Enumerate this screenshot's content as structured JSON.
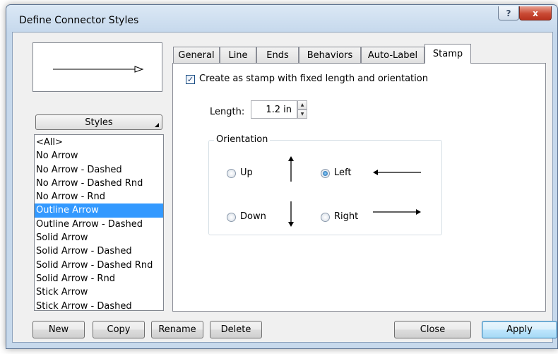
{
  "window": {
    "title": "Define Connector Styles",
    "help_glyph": "?",
    "close_glyph": "x"
  },
  "styles_button": "Styles",
  "style_list": [
    "<All>",
    "No Arrow",
    "No Arrow - Dashed",
    "No Arrow - Dashed Rnd",
    "No Arrow - Rnd",
    "Outline Arrow",
    "Outline Arrow - Dashed",
    "Solid Arrow",
    "Solid Arrow - Dashed",
    "Solid Arrow - Dashed Rnd",
    "Solid Arrow - Rnd",
    "Stick Arrow",
    "Stick Arrow - Dashed"
  ],
  "selected_style": "Outline Arrow",
  "tabs": [
    "General",
    "Line",
    "Ends",
    "Behaviors",
    "Auto-Label",
    "Stamp"
  ],
  "active_tab": "Stamp",
  "stamp": {
    "checkbox_label": "Create as stamp with fixed length and orientation",
    "checkbox_checked": true,
    "check_glyph": "✓",
    "length_label": "Length:",
    "length_value": "1.2 in",
    "orientation_label": "Orientation",
    "orientation_options": [
      "Up",
      "Left",
      "Down",
      "Right"
    ],
    "orientation_selected": "Left"
  },
  "buttons": {
    "new": "New",
    "copy": "Copy",
    "rename": "Rename",
    "delete": "Delete",
    "close": "Close",
    "apply": "Apply"
  },
  "icons": {
    "preview": "arrow-right-outline-icon",
    "up": "arrow-up-icon",
    "left": "arrow-left-icon",
    "down": "arrow-down-icon",
    "right": "arrow-right-icon"
  }
}
